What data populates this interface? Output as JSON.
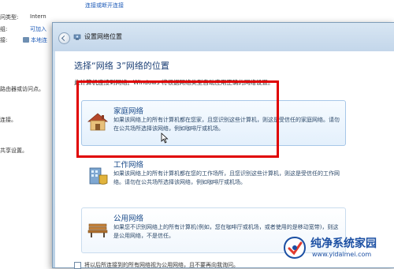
{
  "background": {
    "top_link": "连接或断开连接",
    "row1_label": "问类型:",
    "row1_value": "Intern",
    "row2_label": "组:",
    "row2_value": "可加入",
    "row3_label": "接:",
    "row3_value": "本地连",
    "side1": "路由器或访问点。",
    "side2": "连接。",
    "side3": "共享设置。"
  },
  "dialog": {
    "title": "设置网络位置",
    "heading": "选择“网络 3”网络的位置",
    "intro": "此计算机连接到网络。Windows 将根据网络类型自动应用正确的网络设置。",
    "options": [
      {
        "title": "家庭网络",
        "description": "如果该网络上的所有计算机都在您家，且您识别这些计算机，则这是受信任的家庭网络。请勿在公共场所选择该网络，例如咖啡厅或机场。",
        "icon": "house-icon"
      },
      {
        "title": "工作网络",
        "description": "如果该网络上的所有计算机都在您的工作场所，且您识别这些计算机，则这是受信任的工作网络。请勿在公共场所选择该网络，例如咖啡厅或机场。",
        "icon": "office-building-icon"
      },
      {
        "title": "公用网络",
        "description": "如果您不识别网络上的所有计算机(例如，您在咖啡厅或机场，或者使用的是移动宽带)，则这是公用网络，不是信任。",
        "icon": "park-bench-icon"
      }
    ],
    "checkbox_label": "将以后所连接到的所有网络视为公用网络，且不要再向我询问。"
  },
  "watermark": {
    "title": "纯净系统家园",
    "url": "www.yidaimei.com"
  },
  "colors": {
    "highlight_frame": "#e00000",
    "link": "#1e5bb8",
    "heading": "#1b3f75",
    "watermark": "#1b4fa3"
  }
}
